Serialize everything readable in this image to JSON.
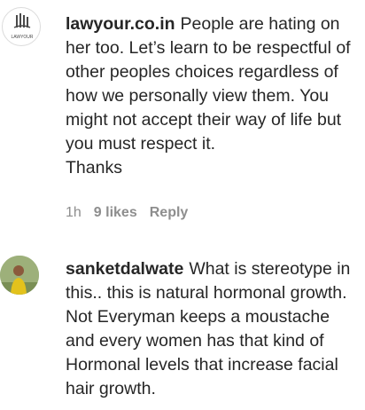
{
  "comments": [
    {
      "username": "lawyour.co.in",
      "text": "People are hating on her too. Let’s learn to be respectful of other peoples choices regardless of how we personally view them. You might not accept their way of life but you must respect it.",
      "text2": "Thanks",
      "time": "1h",
      "likes": "9 likes",
      "reply": "Reply",
      "avatar_label": "LAWYOUR"
    },
    {
      "username": "sanketdalwate",
      "text": "What is stereotype in this.. this is natural hormonal growth. Not Everyman keeps a moustache and every women has that kind of Hormonal levels that increase facial hair growth."
    }
  ]
}
